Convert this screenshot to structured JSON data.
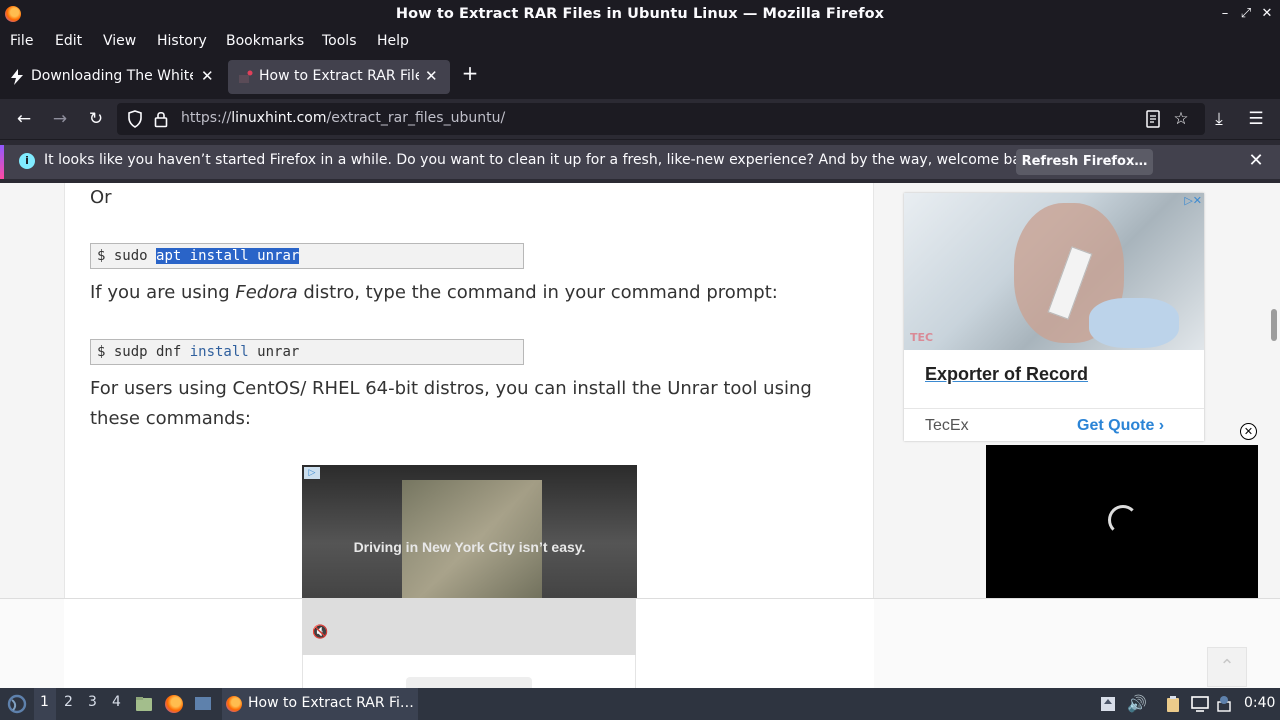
{
  "window": {
    "title": "How to Extract RAR Files in Ubuntu Linux — Mozilla Firefox",
    "controls": [
      "minimize",
      "maximize",
      "close"
    ]
  },
  "menu": [
    "File",
    "Edit",
    "View",
    "History",
    "Bookmarks",
    "Tools",
    "Help"
  ],
  "tabs": [
    {
      "label": "Downloading The White H",
      "icon": "bolt-icon",
      "active": false
    },
    {
      "label": "How to Extract RAR Files",
      "icon": "linuxhint-icon",
      "active": true
    }
  ],
  "navbar": {
    "url_prefix": "https://",
    "url_host": "linuxhint.com",
    "url_path": "/extract_rar_files_ubuntu/"
  },
  "notification": {
    "message": "It looks like you haven’t started Firefox in a while. Do you want to clean it up for a fresh, like-new experience? And by the way, welcome back!",
    "button": "Refresh Firefox…"
  },
  "article": {
    "or_text": "Or",
    "cmd1_prompt": "$ sudo ",
    "cmd1_selected": "apt install unrar",
    "fedora_pre": "If you are using ",
    "fedora_em": "Fedora",
    "fedora_post": " distro, type the command in your command prompt:",
    "cmd2_prompt": "$ sudp dnf ",
    "cmd2_kw": "install",
    "cmd2_rest": " unrar",
    "centos_line1": "For users using CentOS/ RHEL 64-bit distros, you can install the Unrar tool using",
    "centos_line2": "these commands:",
    "video_ad_caption": "Driving in New York City isn’t easy."
  },
  "side_ad": {
    "headline": "Exporter of Record",
    "brand": "TecEx",
    "cta": "Get Quote",
    "photo_logo": "TEC"
  },
  "taskbar": {
    "workspaces": [
      "1",
      "2",
      "3",
      "4"
    ],
    "active_window": "How to Extract RAR Fi…",
    "clock": "0:40"
  }
}
